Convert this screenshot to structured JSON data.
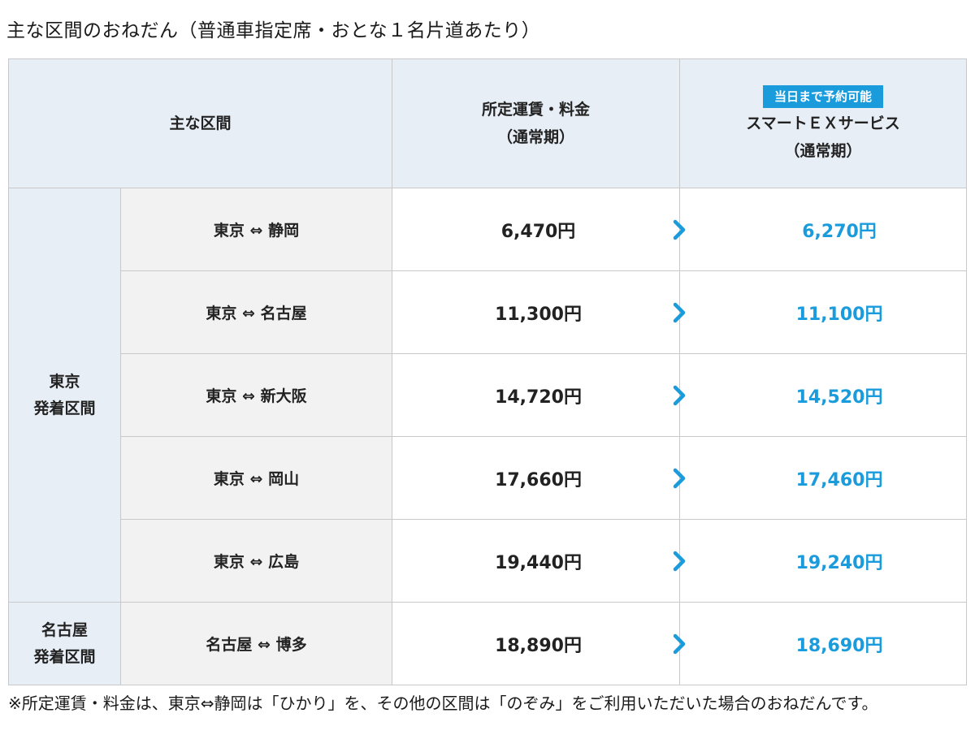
{
  "page": {
    "title": "主な区間のおねだん（普通車指定席・おとな１名片道あたり）"
  },
  "table": {
    "headers": {
      "section": "主な区間",
      "regular_line1": "所定運賃・料金",
      "regular_line2": "（通常期）",
      "smart_badge": "当日まで予約可能",
      "smart_line1": "スマートＥＸサービス",
      "smart_line2": "（通常期）"
    },
    "groups": [
      {
        "label_line1": "東京",
        "label_line2": "発着区間",
        "rows": [
          {
            "route": "東京 ⇔ 静岡",
            "regular": "6,470円",
            "smart": "6,270円"
          },
          {
            "route": "東京 ⇔ 名古屋",
            "regular": "11,300円",
            "smart": "11,100円"
          },
          {
            "route": "東京 ⇔ 新大阪",
            "regular": "14,720円",
            "smart": "14,520円"
          },
          {
            "route": "東京 ⇔ 岡山",
            "regular": "17,660円",
            "smart": "17,460円"
          },
          {
            "route": "東京 ⇔ 広島",
            "regular": "19,440円",
            "smart": "19,240円"
          }
        ]
      },
      {
        "label_line1": "名古屋",
        "label_line2": "発着区間",
        "rows": [
          {
            "route": "名古屋 ⇔ 博多",
            "regular": "18,890円",
            "smart": "18,690円"
          }
        ]
      }
    ],
    "arrow_icon": "chevron-right-icon"
  },
  "note": "※所定運賃・料金は、東京⇔静岡は「ひかり」を、その他の区間は「のぞみ」をご利用いただいた場合のおねだんです。",
  "colors": {
    "accent": "#1a9bdc",
    "header_bg": "#e8eef5",
    "route_bg": "#f2f2f2",
    "border": "#c9c9c9"
  }
}
